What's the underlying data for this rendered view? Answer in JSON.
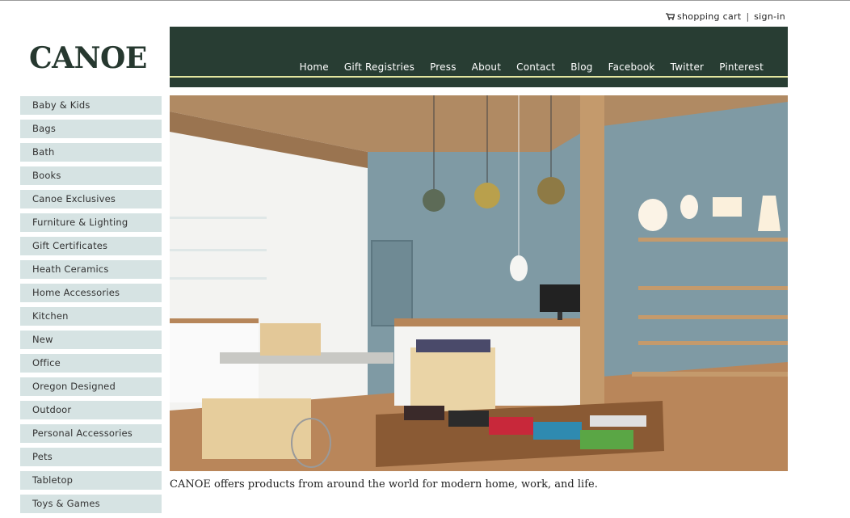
{
  "utility": {
    "cart_label": "shopping cart",
    "separator": "|",
    "signin_label": "sign-in"
  },
  "brand": {
    "logo_text": "CANOE",
    "color": "#26382f"
  },
  "nav": {
    "items": [
      "Home",
      "Gift Registries",
      "Press",
      "About",
      "Contact",
      "Blog",
      "Facebook",
      "Twitter",
      "Pinterest"
    ],
    "bar_color": "#283d33",
    "rule_color": "#e4e6a0"
  },
  "sidebar": {
    "items": [
      "Baby & Kids",
      "Bags",
      "Bath",
      "Books",
      "Canoe Exclusives",
      "Furniture & Lighting",
      "Gift Certificates",
      "Heath Ceramics",
      "Home Accessories",
      "Kitchen",
      "New",
      "Office",
      "Oregon Designed",
      "Outdoor",
      "Personal Accessories",
      "Pets",
      "Tabletop",
      "Toys & Games"
    ],
    "item_bg": "#d6e3e3"
  },
  "main": {
    "caption": "CANOE offers products from around the world for modern home, work, and life."
  }
}
